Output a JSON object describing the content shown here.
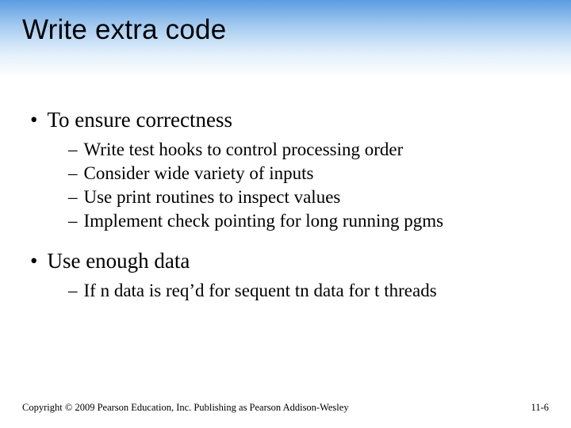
{
  "title": "Write extra code",
  "bullets": [
    {
      "text": "To ensure correctness",
      "subs": [
        "Write test hooks to control processing order",
        "Consider wide variety of inputs",
        "Use print routines to inspect values",
        "Implement check pointing for long running pgms"
      ]
    },
    {
      "text": "Use enough data",
      "subs": [
        "If n data is req’d for sequent tn data for t threads"
      ]
    }
  ],
  "footer": {
    "copyright": "Copyright © 2009 Pearson Education, Inc. Publishing as Pearson Addison-Wesley",
    "pagenum": "11-6"
  }
}
